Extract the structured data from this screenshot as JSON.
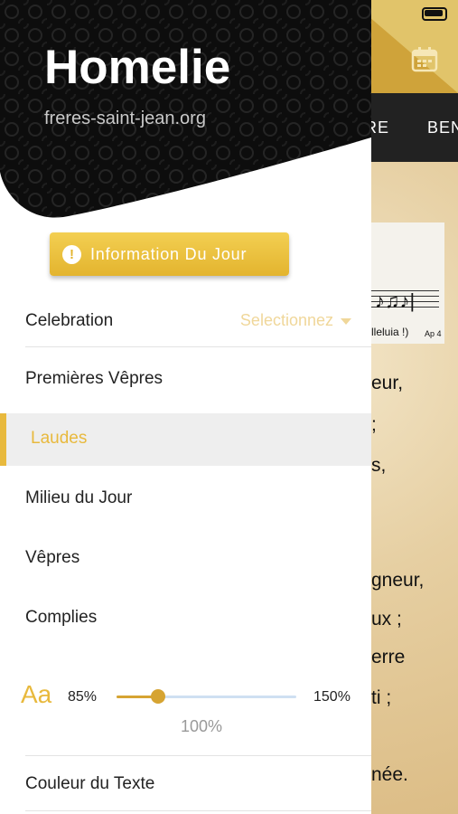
{
  "background": {
    "tabs": [
      "RE",
      "BEN"
    ],
    "music": {
      "lyric": "lleluia !)",
      "ref": "Ap 4"
    },
    "text_lines": [
      "eur,",
      ";",
      "s,",
      "gneur,",
      "ux ;",
      "erre",
      "ti ;",
      "née."
    ]
  },
  "drawer": {
    "title": "Homelie",
    "url": "freres-saint-jean.org",
    "info_button": {
      "label": "Information Du Jour",
      "icon": "exclamation-icon"
    },
    "celebration": {
      "label": "Celebration",
      "select_value": "Selectionnez"
    },
    "menu": [
      {
        "label": "Premières Vêpres",
        "active": false
      },
      {
        "label": "Laudes",
        "active": true
      },
      {
        "label": "Milieu du Jour",
        "active": false
      },
      {
        "label": "Vêpres",
        "active": false
      },
      {
        "label": "Complies",
        "active": false
      }
    ],
    "font_size": {
      "icon_label": "Aa",
      "min_label": "85%",
      "max_label": "150%",
      "current_label": "100%",
      "value_fraction": 0.23
    },
    "text_color_label": "Couleur du Texte"
  },
  "colors": {
    "accent": "#e8b93d",
    "header_black": "#111111",
    "tabbar": "#222222"
  }
}
